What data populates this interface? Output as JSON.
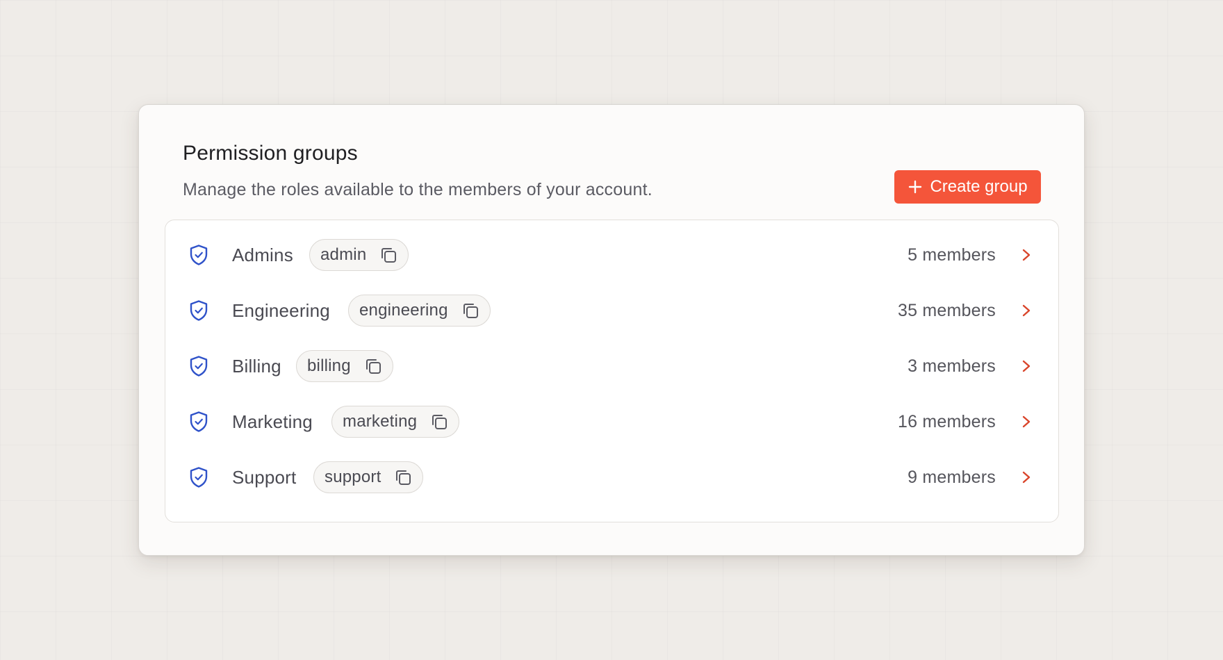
{
  "header": {
    "title": "Permission groups",
    "description": "Manage the roles available to the members of your account.",
    "create_label": "Create group"
  },
  "colors": {
    "accent": "#f4553a",
    "shield": "#2f52c9",
    "chevron": "#d9452b"
  },
  "icons": {
    "group": "shield-check-icon",
    "copy": "copy-icon",
    "row_action": "chevron-right-icon",
    "create": "plus-icon"
  },
  "groups": [
    {
      "name": "Admins",
      "slug": "admin",
      "members": "5 members"
    },
    {
      "name": "Engineering",
      "slug": "engineering",
      "members": "35 members"
    },
    {
      "name": "Billing",
      "slug": "billing",
      "members": "3 members"
    },
    {
      "name": "Marketing",
      "slug": "marketing",
      "members": "16 members"
    },
    {
      "name": "Support",
      "slug": "support",
      "members": "9 members"
    }
  ]
}
